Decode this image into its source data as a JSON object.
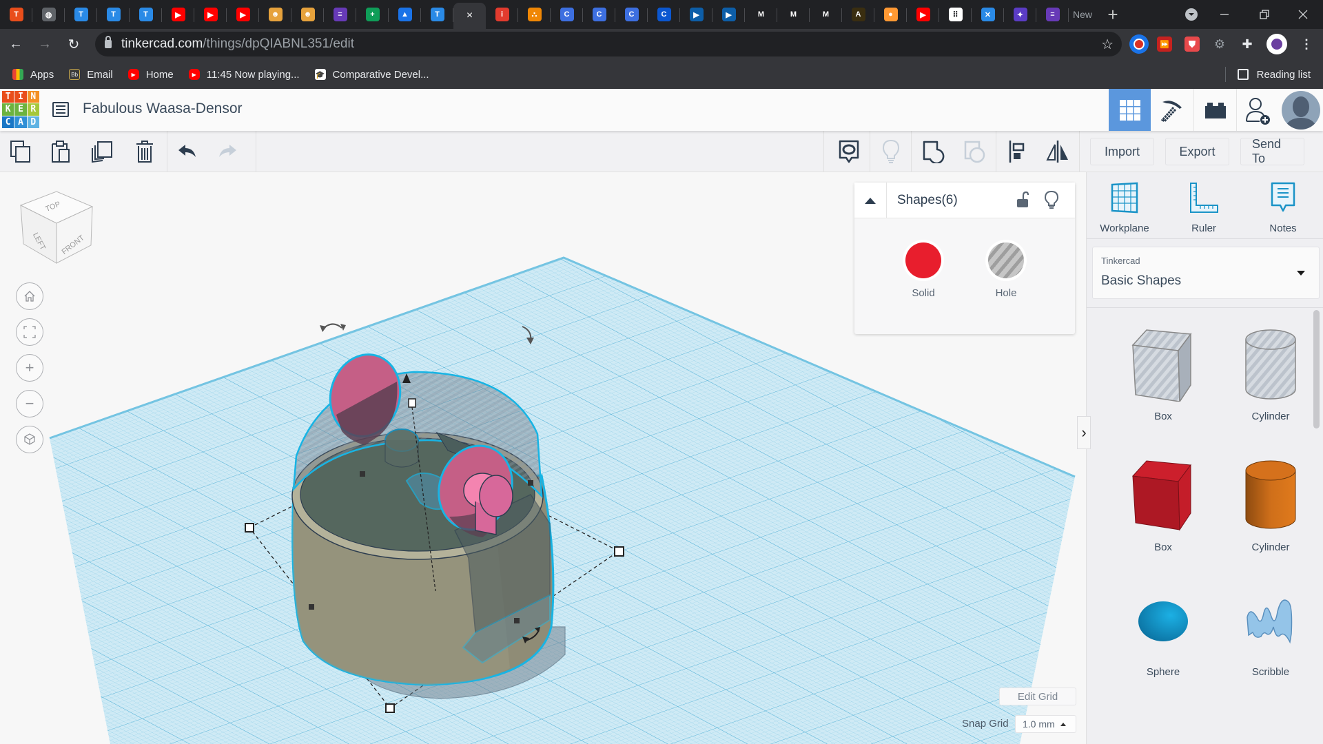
{
  "browser": {
    "tabs": [
      {
        "icon": "tinkercad-icon",
        "color": "#e94e1b",
        "glyph": "T"
      },
      {
        "icon": "globe-icon",
        "color": "#5f6368",
        "glyph": "◍"
      },
      {
        "icon": "t-app-icon",
        "color": "#2a8ae6",
        "glyph": "T"
      },
      {
        "icon": "t-app-icon",
        "color": "#2a8ae6",
        "glyph": "T"
      },
      {
        "icon": "t-app-icon",
        "color": "#2a8ae6",
        "glyph": "T"
      },
      {
        "icon": "youtube-icon",
        "color": "#ff0000",
        "glyph": "▶"
      },
      {
        "icon": "youtube-icon",
        "color": "#ff0000",
        "glyph": "▶"
      },
      {
        "icon": "youtube-icon",
        "color": "#ff0000",
        "glyph": "▶"
      },
      {
        "icon": "robot-icon",
        "color": "#e6a23c",
        "glyph": "☻"
      },
      {
        "icon": "robot-icon",
        "color": "#e6a23c",
        "glyph": "☻"
      },
      {
        "icon": "forms-icon",
        "color": "#673ab7",
        "glyph": "≡"
      },
      {
        "icon": "sheets-plus-icon",
        "color": "#0f9d58",
        "glyph": "+"
      },
      {
        "icon": "drive-icon",
        "color": "#1a73e8",
        "glyph": "▲"
      },
      {
        "icon": "t-app-icon",
        "color": "#2a8ae6",
        "glyph": "T"
      },
      {
        "icon": "active-tab",
        "color": "#35363a",
        "glyph": "×",
        "active": true
      },
      {
        "icon": "i-app-icon",
        "color": "#e23b2e",
        "glyph": "i"
      },
      {
        "icon": "diagram-icon",
        "color": "#f08705",
        "glyph": "⛬"
      },
      {
        "icon": "c-app-icon",
        "color": "#3d6fe0",
        "glyph": "C"
      },
      {
        "icon": "c-app-icon",
        "color": "#3d6fe0",
        "glyph": "C"
      },
      {
        "icon": "c-app-icon",
        "color": "#3d6fe0",
        "glyph": "C"
      },
      {
        "icon": "c-app-icon",
        "color": "#0b57d0",
        "glyph": "C"
      },
      {
        "icon": "play-icon",
        "color": "#0d5ea8",
        "glyph": "▶"
      },
      {
        "icon": "play-icon",
        "color": "#0d5ea8",
        "glyph": "▶"
      },
      {
        "icon": "gmail-icon",
        "color": "#202124",
        "glyph": "M"
      },
      {
        "icon": "gmail-icon",
        "color": "#202124",
        "glyph": "M"
      },
      {
        "icon": "gmail-icon",
        "color": "#202124",
        "glyph": "M"
      },
      {
        "icon": "emblem-icon",
        "color": "#3a2e10",
        "glyph": "A"
      },
      {
        "icon": "india-flag-icon",
        "color": "#ff9933",
        "glyph": "●"
      },
      {
        "icon": "youtube-icon",
        "color": "#ff0000",
        "glyph": "▶"
      },
      {
        "icon": "grid-app-icon",
        "color": "#ffffff",
        "glyph": "⠿"
      },
      {
        "icon": "x-app-icon",
        "color": "#2a8ae6",
        "glyph": "✕"
      },
      {
        "icon": "drone-icon",
        "color": "#5b3cc4",
        "glyph": "✦"
      },
      {
        "icon": "forms-icon",
        "color": "#673ab7",
        "glyph": "≡"
      }
    ],
    "new_tab_partial_label": "New",
    "new_tab_button": "+",
    "url_host": "tinkercad.com",
    "url_path": "/things/dpQIABNL351/edit",
    "bookmarks": [
      {
        "label": "Apps",
        "icon": "apps-grid-icon"
      },
      {
        "label": "Email",
        "icon": "blackboard-icon"
      },
      {
        "label": "Home",
        "icon": "youtube-icon"
      },
      {
        "label": "11:45 Now playing...",
        "icon": "youtube-icon"
      },
      {
        "label": "Comparative Devel...",
        "icon": "graduation-icon"
      }
    ],
    "reading_list": "Reading list"
  },
  "app": {
    "logo_letters": [
      "T",
      "I",
      "N",
      "K",
      "E",
      "R",
      "C",
      "A",
      "D"
    ],
    "logo_colors": [
      "#e94e1b",
      "#e94e1b",
      "#f39125",
      "#6cb33f",
      "#6cb33f",
      "#a6c73a",
      "#1976c5",
      "#2f8fd6",
      "#5fb3e3"
    ],
    "project_title": "Fabulous Waasa-Densor",
    "accent": "#5b97dd"
  },
  "toolbar": {
    "left": [
      "copy",
      "paste",
      "duplicate",
      "delete",
      "undo",
      "redo"
    ],
    "right": [
      "notes-tool",
      "show-all",
      "group",
      "ungroup",
      "align",
      "mirror"
    ],
    "import": "Import",
    "export": "Export",
    "send_to": "Send To"
  },
  "viewcube": {
    "top": "TOP",
    "left": "LEFT",
    "front": "FRONT"
  },
  "inspector": {
    "title": "Shapes(6)",
    "solid": "Solid",
    "hole": "Hole",
    "solid_color": "#e81e2d"
  },
  "right_panel": {
    "tools": [
      {
        "label": "Workplane"
      },
      {
        "label": "Ruler"
      },
      {
        "label": "Notes"
      }
    ],
    "library_category": "Tinkercad",
    "library_name": "Basic Shapes",
    "shapes": [
      {
        "label": "Box"
      },
      {
        "label": "Cylinder"
      },
      {
        "label": "Box"
      },
      {
        "label": "Cylinder"
      },
      {
        "label": "Sphere"
      },
      {
        "label": "Scribble"
      }
    ]
  },
  "grid": {
    "edit_grid": "Edit Grid",
    "snap_label": "Snap Grid",
    "snap_value": "1.0 mm"
  }
}
